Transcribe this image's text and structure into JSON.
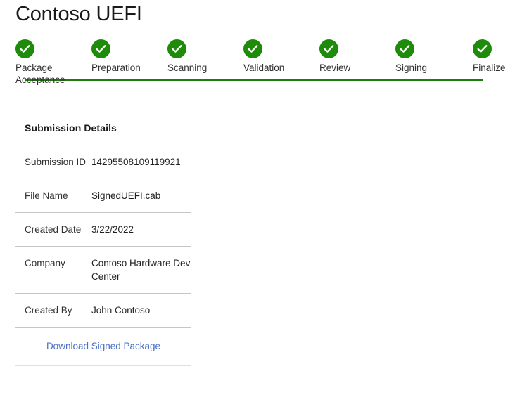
{
  "page": {
    "title": "Contoso UEFI"
  },
  "stepper": {
    "accent_color": "#1e8c0a",
    "track_color": "#1e7c0a",
    "steps": [
      {
        "label": "Package Acceptance",
        "icon": "check-circle-icon",
        "state": "complete"
      },
      {
        "label": "Preparation",
        "icon": "check-circle-icon",
        "state": "complete"
      },
      {
        "label": "Scanning",
        "icon": "check-circle-icon",
        "state": "complete"
      },
      {
        "label": "Validation",
        "icon": "check-circle-icon",
        "state": "complete"
      },
      {
        "label": "Review",
        "icon": "check-circle-icon",
        "state": "complete"
      },
      {
        "label": "Signing",
        "icon": "check-circle-icon",
        "state": "complete"
      },
      {
        "label": "Finalize",
        "icon": "check-circle-icon",
        "state": "complete"
      }
    ]
  },
  "details": {
    "heading": "Submission Details",
    "rows": [
      {
        "key": "Submission ID",
        "value": "14295508109119921"
      },
      {
        "key": "File Name",
        "value": "SignedUEFI.cab"
      },
      {
        "key": "Created Date",
        "value": "3/22/2022"
      },
      {
        "key": "Company",
        "value": "Contoso Hardware Dev Center"
      },
      {
        "key": "Created By",
        "value": "John Contoso"
      }
    ],
    "download_label": "Download Signed Package",
    "link_color": "#4a6fc4"
  }
}
